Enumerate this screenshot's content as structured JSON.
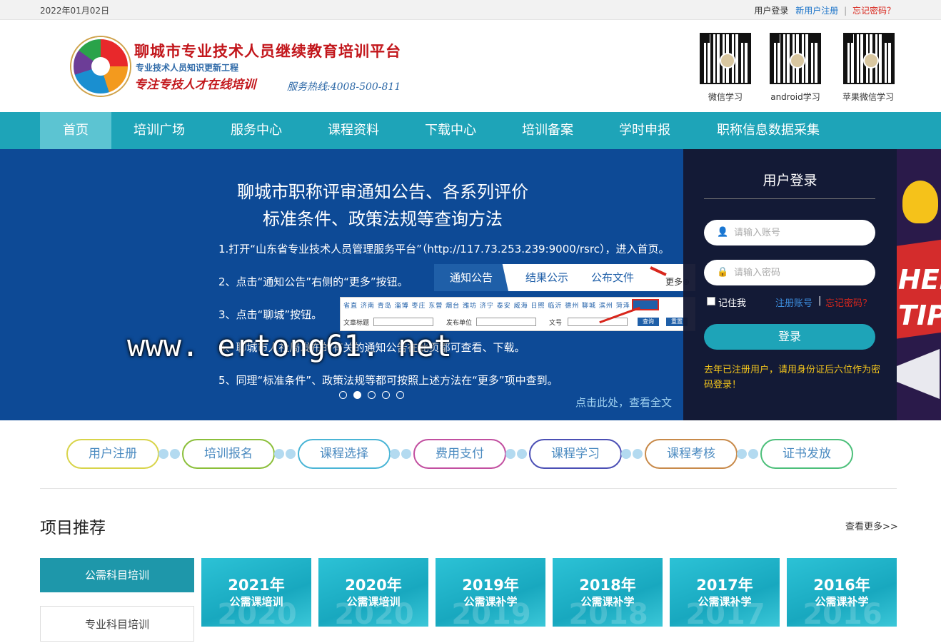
{
  "topbar": {
    "date": "2022年01月02日",
    "login": "用户登录",
    "register": "新用户注册",
    "separator": "|",
    "forgot": "忘记密码？"
  },
  "header": {
    "title": "聊城市专业技术人员继续教育培训平台",
    "subtitle": "专业技术人员知识更新工程",
    "slogan": "专注专技人才在线培训",
    "hotline": "服务热线:4008-500-811",
    "qrcodes": [
      {
        "label": "微信学习"
      },
      {
        "label": "android学习"
      },
      {
        "label": "苹果微信学习"
      }
    ]
  },
  "nav": {
    "items": [
      {
        "label": "首页"
      },
      {
        "label": "培训广场"
      },
      {
        "label": "服务中心"
      },
      {
        "label": "课程资料"
      },
      {
        "label": "下载中心"
      },
      {
        "label": "培训备案"
      },
      {
        "label": "学时申报"
      },
      {
        "label": "职称信息数据采集"
      }
    ],
    "active_index": 0
  },
  "banner": {
    "title_line1": "聊城市职称评审通知公告、各系列评价",
    "title_line2": "标准条件、政策法规等查询方法",
    "steps": [
      "1.打开“山东省专业技术人员管理服务平台”（http://117.73.253.239:9000/rsrc），进入首页。",
      "2、点击“通知公告”右侧的“更多”按钮。",
      "3、点击“聊城”按钮。",
      "4、聊城市人社局发布的有关的通知公告在此页都可查看、下载。",
      "5、同理“标准条件”、政策法规等都可按照上述方法在“更多”项中查到。"
    ],
    "tabs": [
      "通知公告",
      "结果公示",
      "公布文件"
    ],
    "more": "更多⊕",
    "city_row": "省直 济南 青岛 淄博 枣庄 东营 烟台 潍坊 济宁 泰安 威海 日照 临沂 德州 聊城 滨州 菏泽",
    "form_labels": [
      "文章标题",
      "发布单位",
      "文号"
    ],
    "form_buttons": [
      "查询",
      "重置"
    ],
    "read_more": "点击此处，查看全文",
    "slide_count": 5,
    "active_slide": 1,
    "side_text": "HELPFUL TIPS"
  },
  "watermark": "www. ertong61. net",
  "login": {
    "title": "用户登录",
    "account_placeholder": "请输入账号",
    "password_placeholder": "请输入密码",
    "remember": "记住我",
    "register": "注册账号",
    "separator": "|",
    "forgot": "忘记密码？",
    "submit": "登录",
    "tip": "去年已注册用户，请用身份证后六位作为密码登录！"
  },
  "steps": [
    {
      "label": "用户注册",
      "color": "#d8d44a"
    },
    {
      "label": "培训报名",
      "color": "#8bbf3a"
    },
    {
      "label": "课程选择",
      "color": "#4ab5d6"
    },
    {
      "label": "费用支付",
      "color": "#c24fa0"
    },
    {
      "label": "课程学习",
      "color": "#4b4fb5"
    },
    {
      "label": "课程考核",
      "color": "#c88a4a"
    },
    {
      "label": "证书发放",
      "color": "#4cbf7a"
    }
  ],
  "projects": {
    "title": "项目推荐",
    "more": "查看更多>>",
    "categories": [
      "公需科目培训",
      "专业科目培训"
    ],
    "cards": [
      {
        "year": "2021年",
        "name": "公需课培训",
        "bg": "2020"
      },
      {
        "year": "2020年",
        "name": "公需课培训",
        "bg": "2020"
      },
      {
        "year": "2019年",
        "name": "公需课补学",
        "bg": "2019"
      },
      {
        "year": "2018年",
        "name": "公需课补学",
        "bg": "2018"
      },
      {
        "year": "2017年",
        "name": "公需课补学",
        "bg": "2017"
      },
      {
        "year": "2016年",
        "name": "公需课补学",
        "bg": "2016"
      }
    ]
  }
}
